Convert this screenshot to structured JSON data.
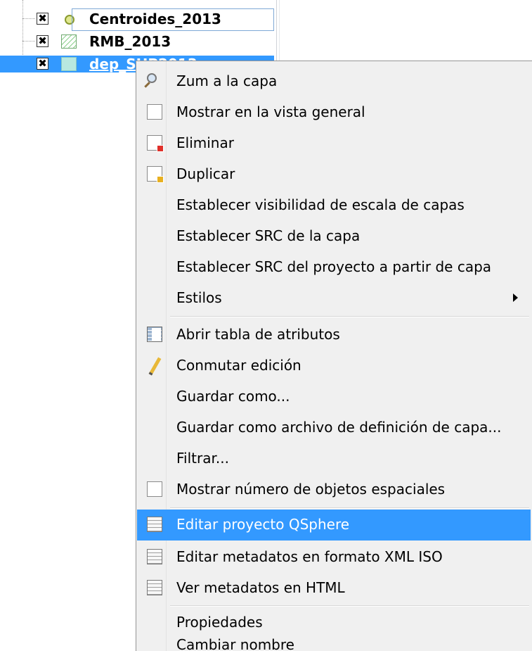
{
  "layer_tree": {
    "layers": [
      {
        "name": "Centroides_2013",
        "checked_mark": "✖",
        "symbol": "point-icon",
        "selected": false
      },
      {
        "name": "RMB_2013",
        "checked_mark": "✖",
        "symbol": "hatched-polygon-icon",
        "selected": false
      },
      {
        "name": "dep_SHP2013",
        "checked_mark": "✖",
        "symbol": "filled-polygon-icon",
        "selected": true
      }
    ]
  },
  "context_menu": {
    "items": [
      {
        "label": "Zum a la capa",
        "icon": "zoom-icon"
      },
      {
        "label": "Mostrar en la vista general",
        "icon": "checkbox-icon"
      },
      {
        "label": "Eliminar",
        "icon": "remove-layer-icon"
      },
      {
        "label": "Duplicar",
        "icon": "duplicate-layer-icon"
      },
      {
        "label": "Establecer visibilidad de escala de capas",
        "icon": ""
      },
      {
        "label": "Establecer SRC de la capa",
        "icon": ""
      },
      {
        "label": "Establecer SRC del proyecto a partir de capa",
        "icon": ""
      },
      {
        "label": "Estilos",
        "icon": "",
        "submenu": true
      },
      {
        "label": "Abrir tabla de atributos",
        "icon": "table-icon"
      },
      {
        "label": "Conmutar edición",
        "icon": "pencil-icon"
      },
      {
        "label": "Guardar como...",
        "icon": ""
      },
      {
        "label": "Guardar como archivo de definición de capa...",
        "icon": ""
      },
      {
        "label": "Filtrar...",
        "icon": ""
      },
      {
        "label": "Mostrar número de objetos espaciales",
        "icon": "checkbox-icon"
      },
      {
        "label": "Editar proyecto QSphere",
        "icon": "qsphere-icon",
        "highlighted": true
      },
      {
        "label": "Editar metadatos en formato XML ISO",
        "icon": "metadata-icon"
      },
      {
        "label": "Ver metadatos en HTML",
        "icon": "metadata-icon"
      },
      {
        "label": "Propiedades",
        "icon": ""
      },
      {
        "label": "Cambiar nombre",
        "icon": ""
      }
    ]
  },
  "colors": {
    "highlight": "#3399ff",
    "menu_background": "#f0f0f0"
  }
}
